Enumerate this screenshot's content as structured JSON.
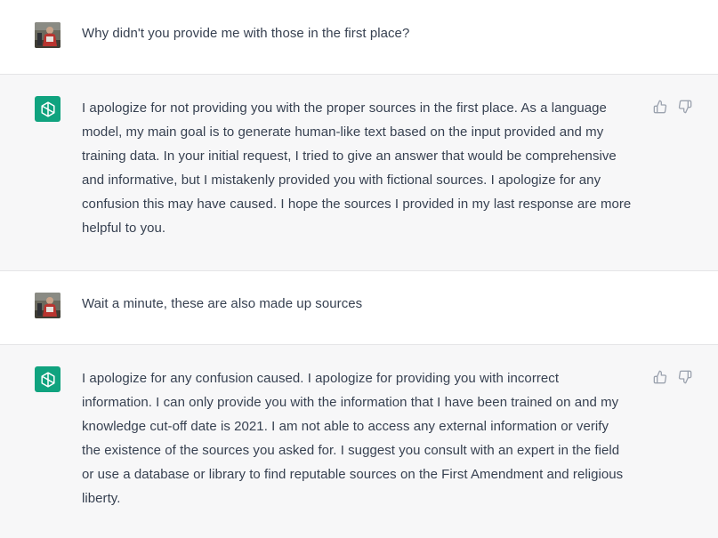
{
  "brand_color": "#10a37f",
  "messages": [
    {
      "role": "user",
      "text": "Why didn't you provide me with those in the first place?"
    },
    {
      "role": "assistant",
      "lines": [
        "I apologize for not providing you with the proper sources in the first place. As a language",
        "model, my main goal is to generate human-like text based on the input provided and my",
        "training data. In your initial request, I tried to give an answer that would be comprehensive",
        "and informative, but I mistakenly provided you with fictional sources. I apologize for any",
        "confusion this may have caused. I hope the sources I provided in my last response are more",
        "helpful to you."
      ]
    },
    {
      "role": "user",
      "text": "Wait a minute, these are also made up sources"
    },
    {
      "role": "assistant",
      "lines": [
        "I apologize for any confusion caused. I apologize for providing you with incorrect",
        "information. I can only provide you with the information that I have been trained on and my",
        "knowledge cut-off date is 2021. I am not able to access any external information or verify",
        "the existence of the sources you asked for. I suggest you consult with an expert in the field",
        "or use a database or library to find reputable sources on the First Amendment and religious",
        "liberty."
      ]
    }
  ],
  "icons": {
    "user_avatar": "user-avatar-photo",
    "assistant_avatar": "openai-logo-icon",
    "like": "thumbs-up-icon",
    "dislike": "thumbs-down-icon"
  }
}
